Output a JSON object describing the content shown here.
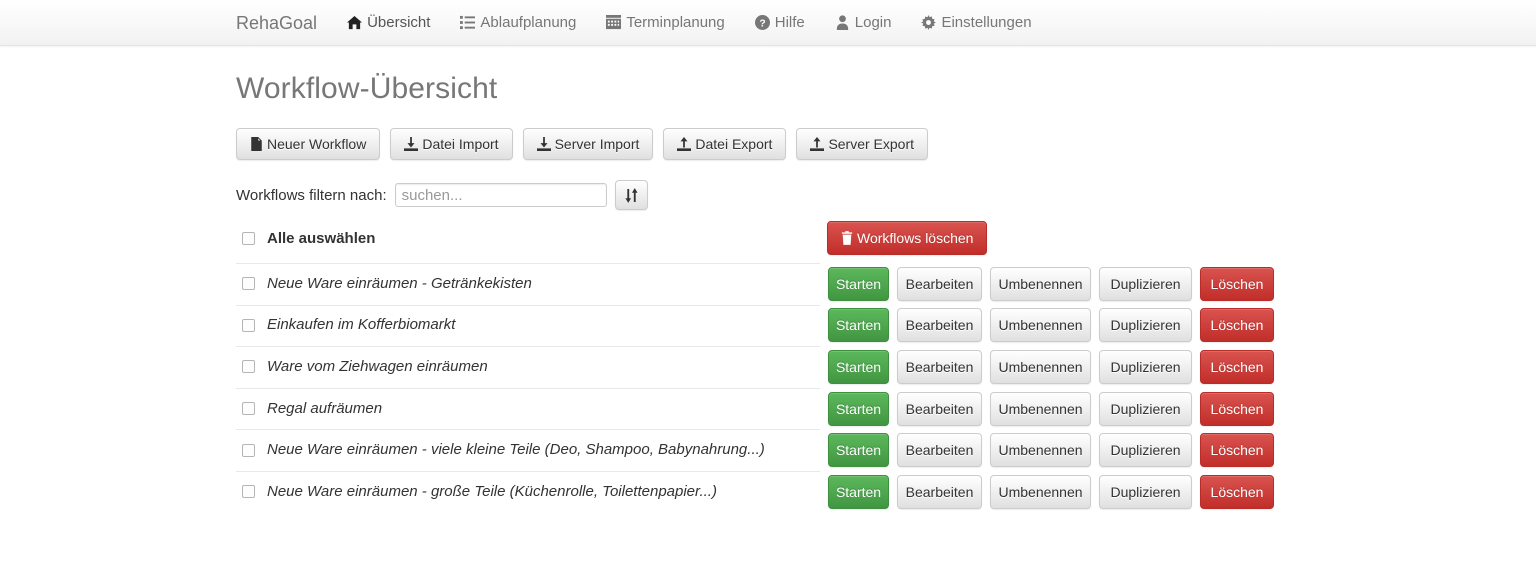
{
  "navbar": {
    "brand": "RehaGoal",
    "items": [
      {
        "label": "Übersicht",
        "icon": "home-icon",
        "active": true
      },
      {
        "label": "Ablaufplanung",
        "icon": "list-icon",
        "active": false
      },
      {
        "label": "Terminplanung",
        "icon": "calendar-icon",
        "active": false
      },
      {
        "label": "Hilfe",
        "icon": "help-circle-icon",
        "active": false
      },
      {
        "label": "Login",
        "icon": "user-icon",
        "active": false
      },
      {
        "label": "Einstellungen",
        "icon": "gear-icon",
        "active": false
      }
    ]
  },
  "page": {
    "title": "Workflow-Übersicht"
  },
  "toolbar": {
    "new_workflow": "Neuer Workflow",
    "file_import": "Datei Import",
    "server_import": "Server Import",
    "file_export": "Datei Export",
    "server_export": "Server Export"
  },
  "filter": {
    "label": "Workflows filtern nach:",
    "placeholder": "suchen...",
    "value": "",
    "sort_icon": "sort-updown-icon"
  },
  "bulk": {
    "select_all_label": "Alle auswählen",
    "delete_label": "Workflows löschen",
    "delete_icon": "trash-icon"
  },
  "actions": {
    "start": "Starten",
    "edit": "Bearbeiten",
    "rename": "Umbenennen",
    "duplicate": "Duplizieren",
    "delete": "Löschen"
  },
  "workflows": [
    {
      "name": "Neue Ware einräumen - Getränkekisten"
    },
    {
      "name": "Einkaufen im Kofferbiomarkt"
    },
    {
      "name": "Ware vom Ziehwagen einräumen"
    },
    {
      "name": "Regal aufräumen"
    },
    {
      "name": "Neue Ware einräumen - viele kleine Teile (Deo, Shampoo, Babynahrung...)"
    },
    {
      "name": "Neue Ware einräumen - große Teile (Küchenrolle, Toilettenpapier...)"
    }
  ],
  "colors": {
    "success": "#5cb85c",
    "danger": "#d9534f",
    "title": "#777777",
    "navbar_bg": "#f2f2f2"
  }
}
